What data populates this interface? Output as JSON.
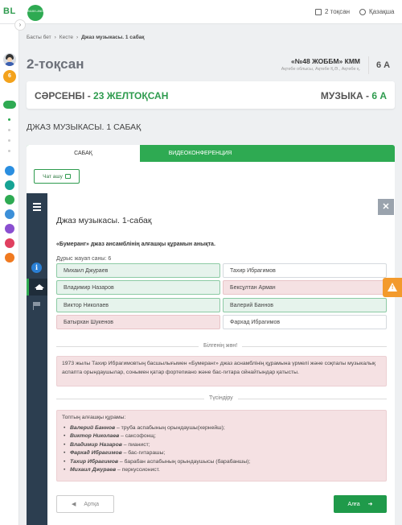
{
  "topbar": {
    "logo": "BL",
    "brand": "BILIM LAND",
    "quarter": "2 тоқсан",
    "language": "Қазақша"
  },
  "rail": {
    "badge": "6"
  },
  "breadcrumb": {
    "items": [
      "Басты бет",
      "Кесте",
      "Джаз музыкасы. 1 сабақ"
    ]
  },
  "header": {
    "quarter_title": "2-тоқсан",
    "school_name": "«№48 ЖОББМ» КММ",
    "school_address": "Ақтөбе облысы, Ақтөбе Қ.Ә., Ақтөбе қ.",
    "grade": "6 А"
  },
  "day_bar": {
    "day_prefix": "СӘРСЕНБІ - ",
    "date": "23 ЖЕЛТОҚСАН",
    "subject_prefix": "МУЗЫКА - ",
    "class": "6 А"
  },
  "lesson_title": "ДЖАЗ МУЗЫКАСЫ. 1 САБАҚ",
  "tabs": {
    "lesson": "САБАҚ",
    "video": "ВИДЕОКОНФЕРЕНЦИЯ"
  },
  "chat_button": "Чат ашу",
  "player": {
    "title": "Джаз музыкасы. 1-сабақ",
    "question": "«Бумеранг» джаз ансамблінің алғашқы құрамын анықта.",
    "correct_count": "Дұрыс жауап саны: 6",
    "answers": [
      {
        "label": "Михаил Джураев",
        "state": "correct"
      },
      {
        "label": "Тахир Ибрагимов",
        "state": "neutral"
      },
      {
        "label": "Владимир Назаров",
        "state": "correct"
      },
      {
        "label": "Бексұлтан Арман",
        "state": "wrong"
      },
      {
        "label": "Виктор Николаев",
        "state": "correct"
      },
      {
        "label": "Валерий Баннов",
        "state": "correct"
      },
      {
        "label": "Батырхан Шукенов",
        "state": "wrong"
      },
      {
        "label": "Фархад Ибрагимов",
        "state": "neutral"
      }
    ],
    "know_label": "Білгенің жөн!",
    "know_text": "1973 жылы Тахир Ибрагимовтың басшылығымен «Бумеранг» джаз аснамблінің құрамына үрмелі және соқпалы музыкалық аспапта орындаушылар, сонымен қатар фортепиано және бас-гитара ойнайтындар қатысты.",
    "explain_label": "Түсіндіру",
    "explain_intro": "Топтың алғашқы құрамы:",
    "explain_items": [
      {
        "name": "Валерий Баннов",
        "role": " – труба аспабының орындаушы(хернейш);"
      },
      {
        "name": "Виктор Николаев",
        "role": " – саксофонщ;"
      },
      {
        "name": "Владимир Назаров",
        "role": " – пианист;"
      },
      {
        "name": "Фархад Ибрагимов",
        "role": " – бас-гитарашы;"
      },
      {
        "name": "Тахир Ибрагимов",
        "role": " – барабан аспабының орындаушысы (барабаншы);"
      },
      {
        "name": "Михаил Джураев",
        "role": " – перкуссионист."
      }
    ],
    "back_button": "Артқа",
    "next_button": "Алға"
  },
  "colors": {
    "accent": "#2eaa52",
    "sidebar": "#2c3e50",
    "correct_bg": "#e6f3ec",
    "wrong_bg": "#f5e1e3",
    "warning": "#f39a2c"
  },
  "icons": [
    "calendar-icon",
    "globe-icon",
    "chevron-right-icon",
    "chat-icon",
    "menu-icon",
    "close-icon",
    "info-icon",
    "graduation-cap-icon",
    "flag-icon",
    "arrow-left-icon",
    "arrow-right-icon",
    "warning-icon"
  ]
}
